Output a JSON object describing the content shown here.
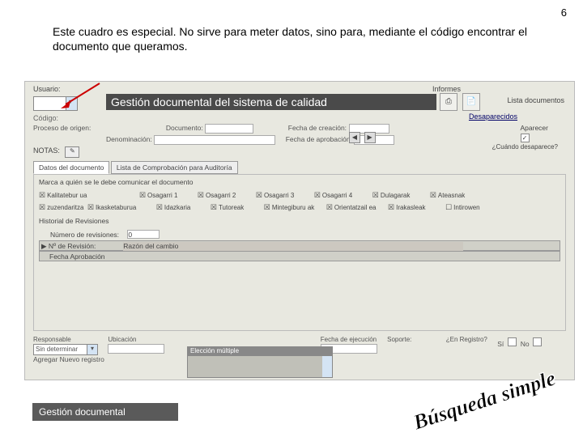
{
  "page_number": "6",
  "explanation": "Este cuadro es especial. No sirve para meter datos, sino para, mediante el código encontrar el documento que queramos.",
  "app_title": "Gestión documental del sistema de calidad",
  "usuario_label": "Usuario:",
  "codigo_label": "Código:",
  "informes_label": "Informes",
  "lista_documentos": "Lista documentos",
  "desaparecidos": "Desaparecidos",
  "aparecer": "Aparecer",
  "cuando_desaparece": "¿Cuándo desaparece?",
  "row_labels": {
    "proceso": "Proceso de origen:",
    "documento": "Documento:",
    "denominacion": "Denominación:",
    "fecha_creacion": "Fecha de creación:",
    "fecha_aprobacion": "Fecha de aprobación:"
  },
  "notas_label": "NOTAS:",
  "tabs": [
    "Datos del documento",
    "Lista de Comprobación para Auditoría"
  ],
  "marca_label": "Marca a quién se le debe comunicar el documento",
  "chk_row1": [
    "Kalitatebur ua",
    "Osagarri 1",
    "Osagarri 2",
    "Osagarri 3",
    "Osagarri 4",
    "Dulagarak",
    "Ateasnak"
  ],
  "chk_row2": [
    "zuzendaritza",
    "Ikasketaburua",
    "Idazkaria",
    "Tutoreak",
    "Mintegiburu ak",
    "Orientatzail ea",
    "Irakasleak",
    "Intirowen"
  ],
  "historial_label": "Historial de Revisiones",
  "num_rev_label": "Número de revisiones:",
  "num_rev_value": "0",
  "rev_row1": "Nº de Revisión:",
  "rev_razon": "Razón del cambio",
  "rev_row2": "Fecha Aprobación",
  "bottom": {
    "responsable": "Responsable",
    "responsable_val": "Sin determinar",
    "ubicacion": "Ubicación",
    "fecha_ejecucion": "Fecha de ejecución",
    "soporte": "Soporte:",
    "en_registro": "¿En Registro?",
    "si": "Sí",
    "no": "No",
    "agregar": "Agregar Nuevo registro"
  },
  "eleccion_multiple": "Elección múltiple",
  "footer_title": "Gestión documental",
  "busqueda_simple": "Búsqueda simple"
}
